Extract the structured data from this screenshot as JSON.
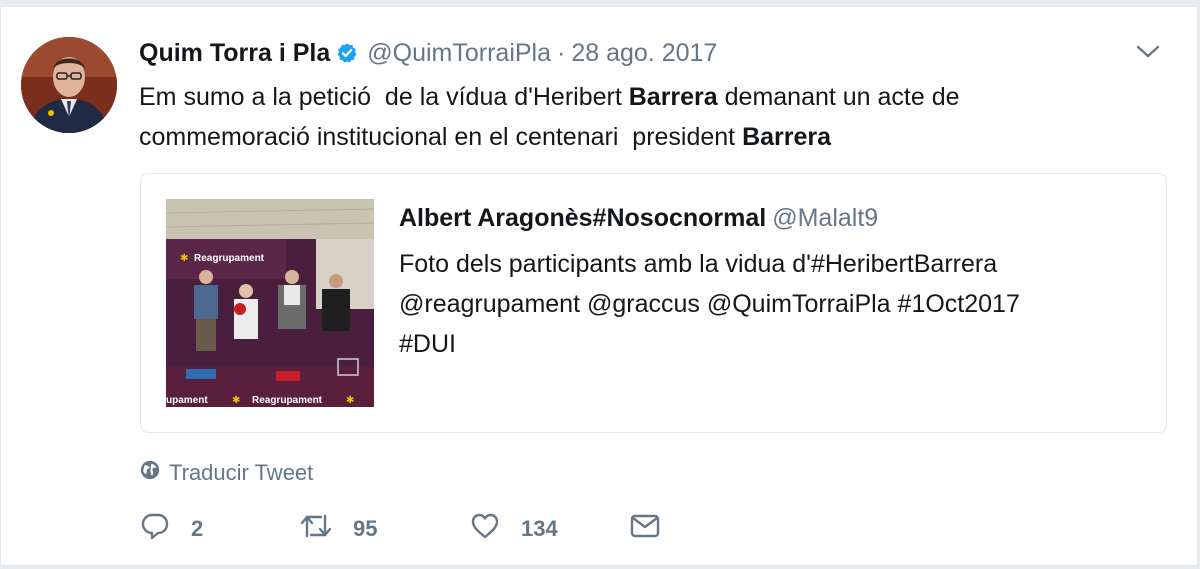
{
  "tweet": {
    "author_name": "Quim Torra i Pla",
    "author_handle": "@QuimTorraiPla",
    "separator": "·",
    "date": "28 ago. 2017",
    "text_parts": [
      "Em sumo a la petició  de la vídua d'Heribert ",
      "Barrera",
      " demanant un acte de\ncommemoració institucional en el centenari  president ",
      "Barrera"
    ],
    "verified_icon": "verified-badge-icon",
    "menu_icon": "chevron-down-icon"
  },
  "quote": {
    "author_name": "Albert Aragonès#Nosocnormal",
    "author_handle": "@Malalt9",
    "text": "Foto dels participants amb la vidua d'#HeribertBarrera\n@reagrupament @graccus @QuimTorraiPla #1Oct2017\n#DUI",
    "image_texts": {
      "banner_top": "Reagrupament",
      "table_left": "upament",
      "table_right": "Reagrupament"
    }
  },
  "translate": {
    "label": "Traducir Tweet",
    "icon": "globe-icon"
  },
  "actions": {
    "reply_count": "2",
    "retweet_count": "95",
    "like_count": "134",
    "icons": [
      "reply-icon",
      "retweet-icon",
      "like-icon",
      "message-icon"
    ]
  },
  "colors": {
    "text": "#14171a",
    "secondary": "#657786",
    "verified": "#1da1f2",
    "border": "#e1e8ed"
  }
}
